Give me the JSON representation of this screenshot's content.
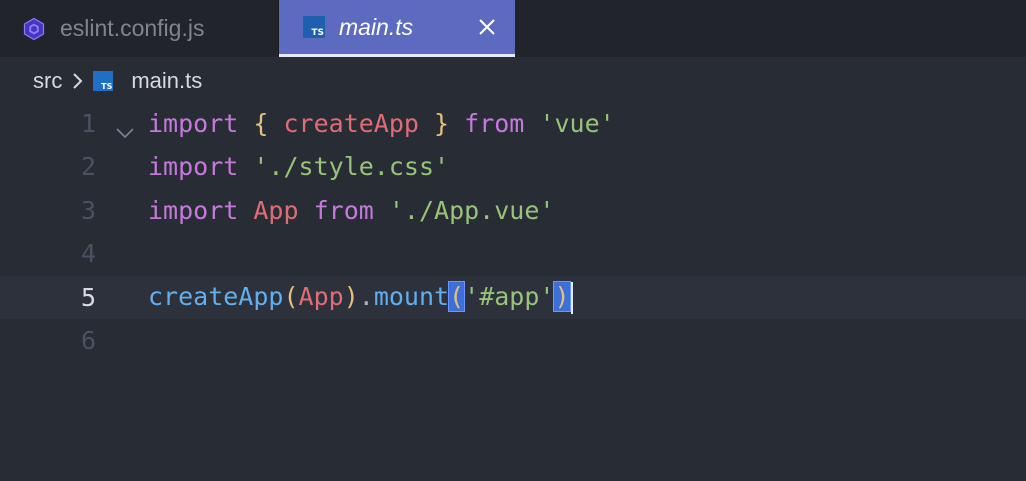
{
  "tabs": [
    {
      "label": "eslint.config.js",
      "icon": "eslint-icon",
      "active": false
    },
    {
      "label": "main.ts",
      "icon": "typescript-file-icon",
      "icon_text": "TS",
      "active": true
    }
  ],
  "breadcrumb": {
    "folder": "src",
    "file": "main.ts",
    "file_icon_text": "TS"
  },
  "editor": {
    "current_line": 5,
    "lines": [
      {
        "number": "1",
        "tokens": [
          "import",
          " ",
          "{",
          " ",
          "createApp",
          " ",
          "}",
          " ",
          "from",
          " ",
          "'vue'"
        ]
      },
      {
        "number": "2",
        "tokens": [
          "import",
          " ",
          "'./style.css'"
        ]
      },
      {
        "number": "3",
        "tokens": [
          "import",
          " ",
          "App",
          " ",
          "from",
          " ",
          "'./App.vue'"
        ]
      },
      {
        "number": "4",
        "tokens": []
      },
      {
        "number": "5",
        "tokens": [
          "createApp",
          "(",
          "App",
          ")",
          ".",
          "mount",
          "(",
          "'#app'",
          ")"
        ]
      },
      {
        "number": "6",
        "tokens": []
      }
    ]
  },
  "colors": {
    "background": "#282c34",
    "tabbar": "#21252b",
    "active_tab": "#5c6bc0",
    "keyword": "#c678dd",
    "identifier": "#e06c75",
    "string": "#98c379",
    "brace": "#e5c07b",
    "function_call": "#61afef",
    "bracket_match": "#3d6fd8"
  }
}
